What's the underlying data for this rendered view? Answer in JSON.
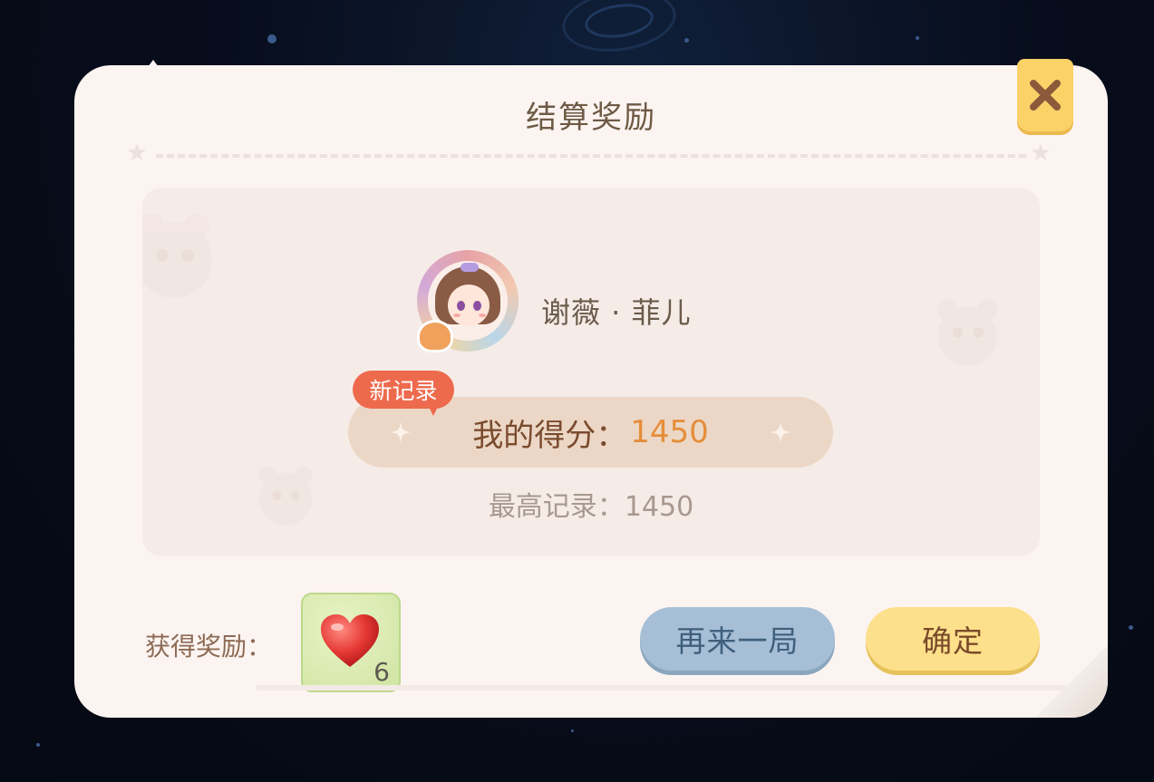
{
  "dialog": {
    "title": "结算奖励",
    "close_icon": "close-icon"
  },
  "player": {
    "name": "谢薇 · 菲儿",
    "avatar_icon": "player-avatar"
  },
  "score": {
    "new_record_badge": "新记录",
    "label": "我的得分：",
    "value": "1450",
    "best_label": "最高记录：",
    "best_value": "1450"
  },
  "reward": {
    "label": "获得奖励：",
    "item_icon": "heart-icon",
    "count": "6"
  },
  "buttons": {
    "play_again": "再来一局",
    "confirm": "确定"
  },
  "colors": {
    "card_bg": "#fcf4f1",
    "score_accent": "#e58d3a",
    "badge_red": "#ee6a4d",
    "btn_blue": "#a6bfd6",
    "btn_yellow": "#fde08b"
  }
}
